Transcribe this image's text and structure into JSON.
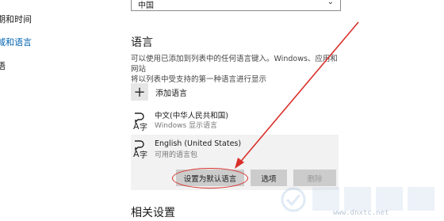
{
  "nav": {
    "items": [
      {
        "label": "期和时间",
        "active": false
      },
      {
        "label": "域和语言",
        "active": true
      },
      {
        "label": "语",
        "active": false
      }
    ]
  },
  "region": {
    "country_value": "中国"
  },
  "languages": {
    "heading": "语言",
    "description_line1": "可以使用已添加到列表中的任何语言键入。Windows、应用和网站",
    "description_line2": "将以列表中受支持的第一种语言进行显示",
    "add_label": "添加语言",
    "items": [
      {
        "name": "中文(中华人民共和国)",
        "sub": "Windows 显示语言"
      },
      {
        "name": "English (United States)",
        "sub": "可用的语言包"
      }
    ],
    "set_default_label": "设置为默认语言",
    "options_label": "选项",
    "remove_label": "删除"
  },
  "related": {
    "heading": "相关设置"
  },
  "watermark": {
    "text": "www.dnxtc.net"
  },
  "colors": {
    "accent": "#0063b1",
    "annotation_red": "#d9302b",
    "button_gray": "#cccccc",
    "selected_row": "#f2f2f2"
  }
}
